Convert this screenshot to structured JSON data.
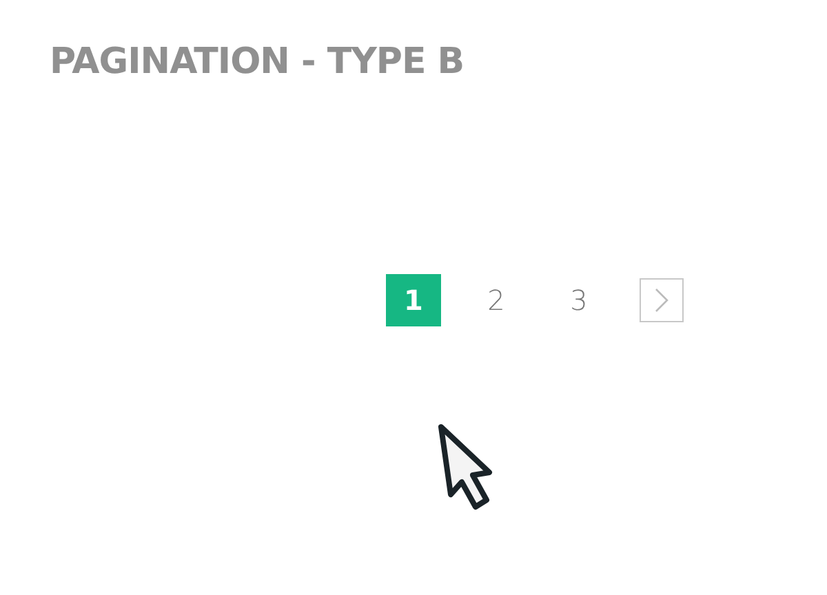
{
  "title": "PAGINATION - TYPE B",
  "pages": [
    {
      "label": "1",
      "selected": true
    },
    {
      "label": "2",
      "selected": false
    },
    {
      "label": "3",
      "selected": false
    }
  ]
}
